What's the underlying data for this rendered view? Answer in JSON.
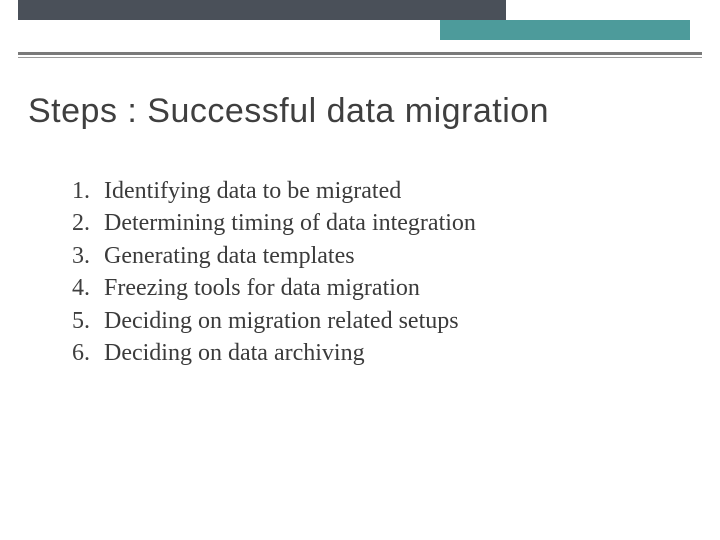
{
  "title": "Steps : Successful data migration",
  "items": [
    {
      "n": "1.",
      "t": "Identifying data to be migrated"
    },
    {
      "n": "2.",
      "t": "Determining timing of data integration"
    },
    {
      "n": "3.",
      "t": "Generating data templates"
    },
    {
      "n": "4.",
      "t": "Freezing tools for data migration"
    },
    {
      "n": "5.",
      "t": "Deciding on migration related setups"
    },
    {
      "n": "6.",
      "t": "Deciding on data archiving"
    }
  ]
}
